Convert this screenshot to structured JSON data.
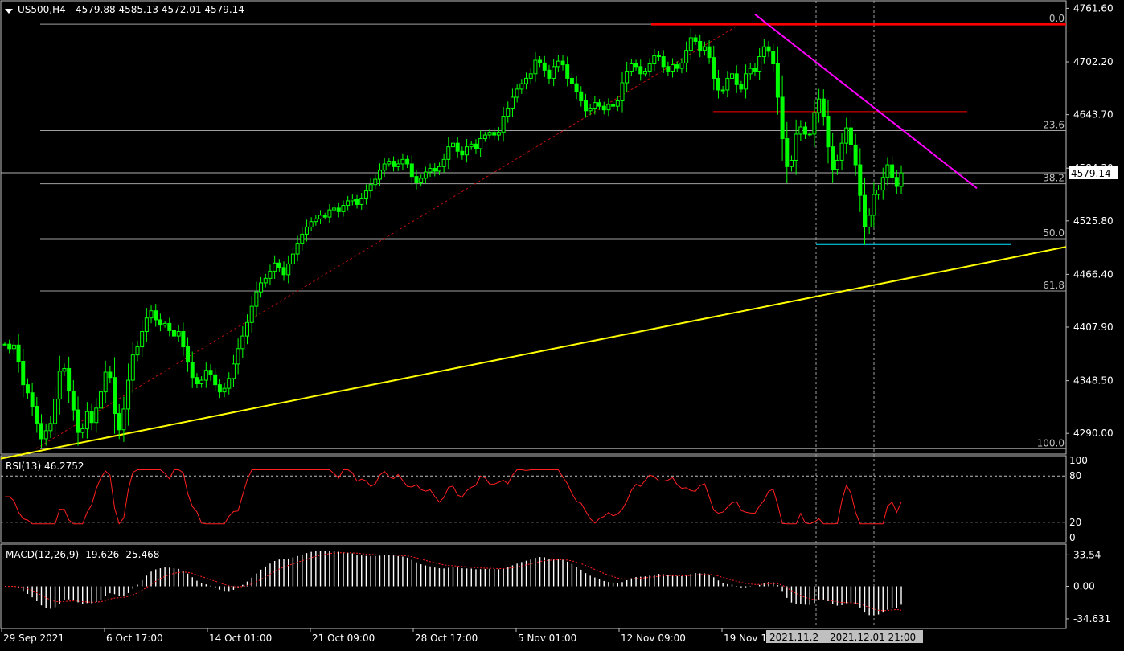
{
  "header": {
    "symbol_tf": "US500,H4",
    "ohlc": "4579.88 4585.13 4572.01 4579.14"
  },
  "colors": {
    "background": "#000000",
    "candle": "#00ff00",
    "grid": "#c0c0c0",
    "fib_line": "#a0a0a0",
    "top_line": "#ff0000",
    "resistance_line": "#ff0000",
    "trend_down": "#ff00ff",
    "trend_up": "#ffff00",
    "support_line": "#00e5ff",
    "rsi_line": "#ff2020",
    "macd_signal": "#ff2020",
    "macd_hist": "#ffffff"
  },
  "chart_data": [
    {
      "type": "candlestick",
      "title": "US500,H4",
      "ohlc_label": "4579.88 4585.13 4572.01 4579.14",
      "last_price": 4579.14,
      "last_price_label": "4579.14",
      "ylim": [
        4267,
        4770
      ],
      "y_ticks": [
        {
          "value": 4761.6,
          "label": "4761.60"
        },
        {
          "value": 4702.2,
          "label": "4702.20"
        },
        {
          "value": 4643.7,
          "label": "4643.70"
        },
        {
          "value": 4584.3,
          "label": "4584.30"
        },
        {
          "value": 4525.8,
          "label": "4525.80"
        },
        {
          "value": 4466.4,
          "label": "4466.40"
        },
        {
          "value": 4407.9,
          "label": "4407.90"
        },
        {
          "value": 4348.5,
          "label": "4348.50"
        },
        {
          "value": 4290.0,
          "label": "4290.00"
        }
      ],
      "x_labels": [
        "29 Sep 2021",
        "6 Oct 17:00",
        "14 Oct 01:00",
        "21 Oct 09:00",
        "28 Oct 17:00",
        "5 Nov 01:00",
        "12 Nov 09:00",
        "19 Nov 1"
      ],
      "x_markers": [
        "2021.11.2",
        "2021.12.01 21:00"
      ],
      "fibonacci": [
        {
          "level": "0.0",
          "price": 4744
        },
        {
          "level": "23.6",
          "price": 4626
        },
        {
          "level": "38.2",
          "price": 4567
        },
        {
          "level": "50.0",
          "price": 4506
        },
        {
          "level": "61.8",
          "price": 4448
        },
        {
          "level": "100.0",
          "price": 4273
        }
      ],
      "closes": [
        4389,
        4384,
        4388,
        4370,
        4344,
        4335,
        4320,
        4301,
        4284,
        4293,
        4301,
        4328,
        4359,
        4362,
        4337,
        4316,
        4291,
        4295,
        4314,
        4302,
        4318,
        4336,
        4358,
        4352,
        4312,
        4294,
        4317,
        4349,
        4377,
        4386,
        4403,
        4418,
        4426,
        4416,
        4410,
        4412,
        4404,
        4398,
        4403,
        4386,
        4369,
        4352,
        4345,
        4349,
        4360,
        4355,
        4344,
        4336,
        4340,
        4351,
        4367,
        4384,
        4398,
        4413,
        4431,
        4447,
        4457,
        4462,
        4470,
        4479,
        4474,
        4466,
        4478,
        4489,
        4501,
        4511,
        4519,
        4525,
        4528,
        4532,
        4530,
        4538,
        4540,
        4536,
        4543,
        4548,
        4550,
        4544,
        4551,
        4559,
        4566,
        4572,
        4582,
        4589,
        4592,
        4586,
        4589,
        4594,
        4589,
        4575,
        4568,
        4573,
        4580,
        4584,
        4581,
        4586,
        4594,
        4608,
        4612,
        4603,
        4599,
        4608,
        4611,
        4606,
        4617,
        4621,
        4624,
        4621,
        4624,
        4642,
        4651,
        4663,
        4672,
        4678,
        4684,
        4689,
        4704,
        4701,
        4693,
        4684,
        4697,
        4703,
        4699,
        4684,
        4678,
        4669,
        4659,
        4648,
        4651,
        4657,
        4653,
        4649,
        4655,
        4653,
        4659,
        4679,
        4692,
        4700,
        4697,
        4689,
        4692,
        4700,
        4709,
        4708,
        4697,
        4692,
        4699,
        4695,
        4701,
        4715,
        4729,
        4725,
        4715,
        4719,
        4707,
        4684,
        4671,
        4671,
        4684,
        4689,
        4677,
        4672,
        4689,
        4695,
        4692,
        4708,
        4719,
        4714,
        4700,
        4663,
        4617,
        4586,
        4593,
        4622,
        4630,
        4622,
        4622,
        4646,
        4661,
        4642,
        4608,
        4583,
        4593,
        4612,
        4629,
        4610,
        4588,
        4554,
        4519,
        4532,
        4555,
        4560,
        4574,
        4588,
        4574,
        4564,
        4579
      ]
    },
    {
      "type": "line",
      "title": "RSI(13) 46.2752",
      "ylim": [
        0,
        100
      ],
      "y_ticks": [
        {
          "value": 100,
          "label": "100"
        },
        {
          "value": 80,
          "label": "80"
        },
        {
          "value": 20,
          "label": "20"
        },
        {
          "value": 0,
          "label": "0"
        }
      ],
      "levels": [
        80,
        20
      ],
      "series": [
        {
          "name": "RSI(13)",
          "last": 46.2752
        }
      ]
    },
    {
      "type": "bar",
      "title": "MACD(12,26,9) -19.626 -25.468",
      "ylim": [
        -45,
        45
      ],
      "y_ticks": [
        {
          "value": 33.54,
          "label": "33.54"
        },
        {
          "value": 0,
          "label": "0.00"
        },
        {
          "value": -34.631,
          "label": "-34.631"
        }
      ],
      "series": [
        {
          "name": "MACD(12,26,9)",
          "last": -19.626
        },
        {
          "name": "Signal",
          "last": -25.468
        }
      ]
    }
  ]
}
